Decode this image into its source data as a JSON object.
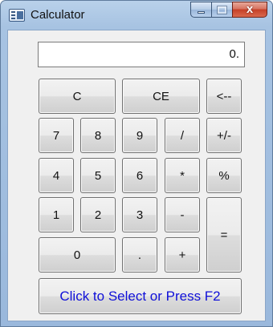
{
  "window": {
    "title": "Calculator",
    "close_label": "x"
  },
  "display": {
    "value": "0."
  },
  "buttons": {
    "clear": "C",
    "clear_entry": "CE",
    "backspace": "<--",
    "seven": "7",
    "eight": "8",
    "nine": "9",
    "divide": "/",
    "plus_minus": "+/-",
    "four": "4",
    "five": "5",
    "six": "6",
    "multiply": "*",
    "percent": "%",
    "one": "1",
    "two": "2",
    "three": "3",
    "subtract": "-",
    "equals": "=",
    "zero": "0",
    "decimal": ".",
    "add": "+",
    "select": "Click to Select or Press F2"
  },
  "colors": {
    "select_text": "#1010d8",
    "close_button": "#c54027"
  }
}
